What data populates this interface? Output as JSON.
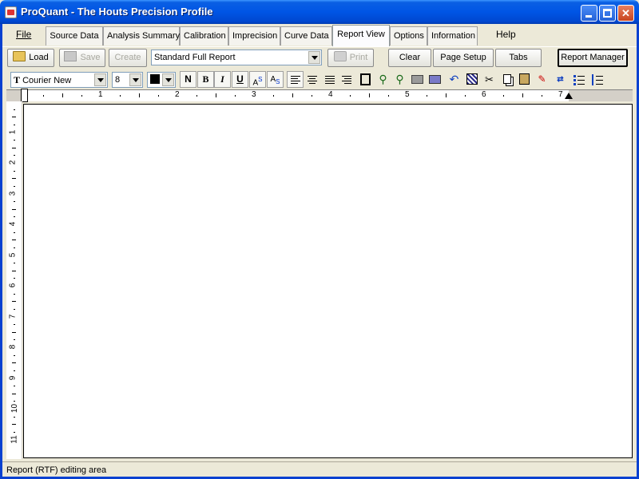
{
  "window": {
    "title": "ProQuant  - The Houts Precision Profile"
  },
  "menu": {
    "file": "File",
    "help": "Help"
  },
  "tabs": [
    {
      "label": "Source Data"
    },
    {
      "label": "Analysis Summary"
    },
    {
      "label": "Calibration"
    },
    {
      "label": "Imprecision"
    },
    {
      "label": "Curve Data"
    },
    {
      "label": "Report View"
    },
    {
      "label": "Options"
    },
    {
      "label": "Information"
    }
  ],
  "toolbar": {
    "load": "Load",
    "save": "Save",
    "create": "Create",
    "report_select": "Standard Full Report",
    "print": "Print",
    "clear": "Clear",
    "page_setup": "Page Setup",
    "tabs": "Tabs",
    "report_manager": "Report Manager"
  },
  "format": {
    "font": "Courier New",
    "size": "8",
    "normal": "N",
    "bold": "B",
    "italic": "I",
    "underline": "U",
    "superscript": "A",
    "sup_mark": "S",
    "subscript": "A",
    "sub_mark": "S",
    "color": "#000000"
  },
  "ruler": {
    "h_numbers": [
      "1",
      "2",
      "3",
      "4",
      "5",
      "6",
      "7"
    ],
    "v_numbers": [
      "1",
      "2",
      "3",
      "4",
      "5",
      "6",
      "7",
      "8",
      "9",
      "10",
      "11"
    ]
  },
  "status": {
    "text": "Report (RTF) editing area"
  }
}
